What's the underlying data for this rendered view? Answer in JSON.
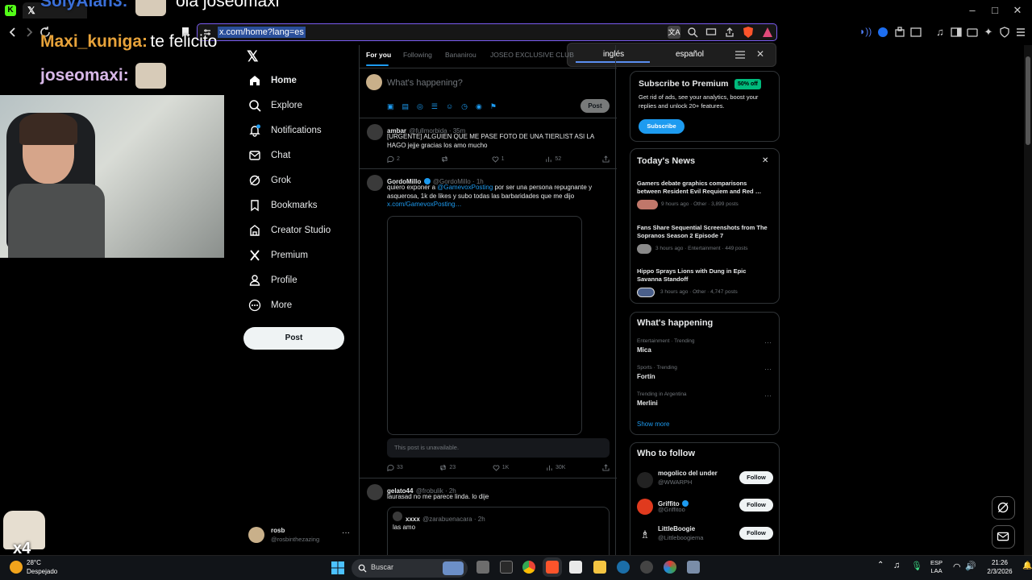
{
  "browser": {
    "url": "x.com/home?lang=es",
    "translate": {
      "lang1": "inglés",
      "lang2": "español"
    }
  },
  "overlay": {
    "chat": [
      {
        "user": "SolyAlan3:",
        "message": "ola joseomaxi",
        "color": "#3a6fd8"
      },
      {
        "user": "Maxi_kuniga:",
        "message": "te felicito",
        "color": "#e8a33a"
      },
      {
        "user": "joseomaxi:",
        "message": "",
        "color": "#d8b8e8"
      }
    ],
    "counter": "x4"
  },
  "nav": {
    "items": [
      {
        "label": "Home",
        "icon": "home-icon"
      },
      {
        "label": "Explore",
        "icon": "search-icon"
      },
      {
        "label": "Notifications",
        "icon": "bell-icon"
      },
      {
        "label": "Chat",
        "icon": "chat-icon"
      },
      {
        "label": "Grok",
        "icon": "grok-icon"
      },
      {
        "label": "Bookmarks",
        "icon": "bookmark-icon"
      },
      {
        "label": "Creator Studio",
        "icon": "creator-icon"
      },
      {
        "label": "Premium",
        "icon": "x-icon"
      },
      {
        "label": "Profile",
        "icon": "person-icon"
      },
      {
        "label": "More",
        "icon": "more-icon"
      }
    ],
    "post_button": "Post",
    "account": {
      "name": "rosb",
      "handle": "@rosbinthezazing"
    }
  },
  "feed": {
    "tabs": [
      "For you",
      "Following",
      "Bananirou",
      "JOSEO EXCLUSIVE CLUB"
    ],
    "composer_placeholder": "What's happening?",
    "composer_post": "Post",
    "posts": [
      {
        "name": "ambar",
        "handle": "@fullmorbida · 35m",
        "text": "[URGENTE] ALGUIEN QUE ME PASE FOTO DE UNA TIERLIST ASI LA HAGO jejje gracias los amo mucho",
        "replies": "2",
        "reposts": "",
        "likes": "1",
        "views": "52"
      },
      {
        "name": "GordoMillo",
        "handle": "@GordoMillo · 1h",
        "text_pre": "quiero exponer a ",
        "mention": "@GamevoxPosting",
        "text_post": " por ser una persona repugnante y asquerosa, 1k de likes y subo todas las barbaridades que me dijo",
        "link": "x.com/GamevoxPosting…",
        "unavailable": "This post is unavailable.",
        "replies": "33",
        "reposts": "23",
        "likes": "1K",
        "views": "30K"
      },
      {
        "name": "gelato44",
        "handle": "@frobulik · 2h",
        "text": "laurasad no me parece linda. lo dije",
        "quote": {
          "name": "xxxx",
          "handle": "@zarabuenacara · 2h",
          "text": "las amo"
        }
      }
    ]
  },
  "premium": {
    "title": "Subscribe to Premium",
    "badge": "50% off",
    "text": "Get rid of ads, see your analytics, boost your replies and unlock 20+ features.",
    "button": "Subscribe"
  },
  "news": {
    "title": "Today's News",
    "items": [
      {
        "title": "Gamers debate graphics comparisons between Resident Evil Requiem and Red …",
        "meta": "9 hours ago · Other · 3,899 posts"
      },
      {
        "title": "Fans Share Sequential Screenshots from The Sopranos Season 2 Episode 7",
        "meta": "3 hours ago · Entertainment · 449 posts"
      },
      {
        "title": "Hippo Sprays Lions with Dung in Epic Savanna Standoff",
        "meta": "3 hours ago · Other · 4,747 posts"
      }
    ]
  },
  "happening": {
    "title": "What's happening",
    "items": [
      {
        "category": "Entertainment · Trending",
        "name": "Mica"
      },
      {
        "category": "Sports · Trending",
        "name": "Fortín"
      },
      {
        "category": "Trending in Argentina",
        "name": "Merlini"
      }
    ],
    "show_more": "Show more"
  },
  "who_to_follow": {
    "title": "Who to follow",
    "items": [
      {
        "name": "mogolico del under",
        "handle": "@WWARPH",
        "verified": false
      },
      {
        "name": "Griffito",
        "handle": "@Griffitoo",
        "verified": true
      },
      {
        "name": "LittleBoogie",
        "handle": "@Littleboogiema",
        "verified": false
      }
    ],
    "button": "Follow"
  },
  "taskbar": {
    "weather_temp": "28°C",
    "weather_desc": "Despejado",
    "search_placeholder": "Buscar",
    "lang": "ESP",
    "lang2": "LAA",
    "time": "21:26",
    "date": "2/3/2026"
  },
  "colors": {
    "accent": "#1d9bf0",
    "border": "#2f3336",
    "muted": "#71767b",
    "premium_badge": "#00ba7c"
  }
}
